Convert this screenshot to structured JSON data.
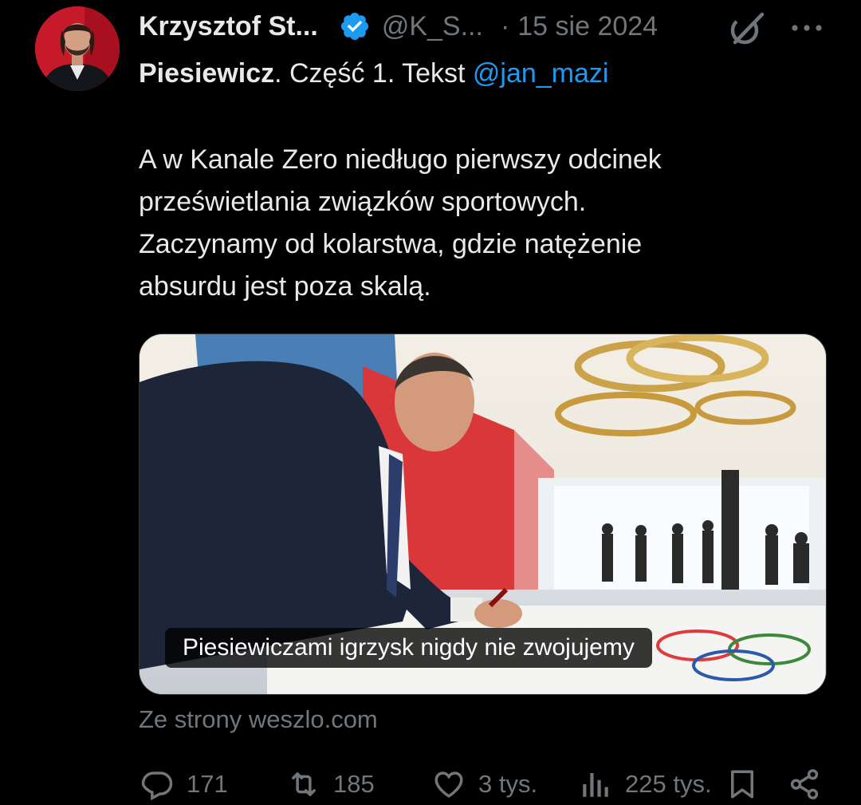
{
  "author": {
    "name": "Krzysztof St...",
    "handle": "@K_S...",
    "separator": "·",
    "date": "15 sie 2024"
  },
  "tweet": {
    "line1_bold": "Piesiewicz",
    "line1_rest": ". Część 1. Tekst ",
    "line1_mention": "@jan_mazi",
    "body_lines": [
      "A w Kanale Zero niedługo pierwszy odcinek",
      "prześwietlania związków sportowych.",
      "Zaczynamy od kolarstwa, gdzie natężenie",
      "absurdu jest poza skalą."
    ]
  },
  "card": {
    "title": "Piesiewiczami igrzysk nigdy nie zwojujemy",
    "source": "Ze strony weszlo.com"
  },
  "actions": {
    "reply": {
      "icon": "reply-icon",
      "count": "171"
    },
    "retweet": {
      "icon": "retweet-icon",
      "count": "185"
    },
    "like": {
      "icon": "heart-icon",
      "count": "3 tys."
    },
    "views": {
      "icon": "views-icon",
      "count": "225 tys."
    },
    "bookmark": {
      "icon": "bookmark-icon"
    },
    "share": {
      "icon": "share-icon"
    }
  },
  "colors": {
    "background": "#000000",
    "text": "#e7e9ea",
    "muted": "#71767b",
    "link": "#1d9bf0",
    "verified": "#1d9bf0"
  }
}
